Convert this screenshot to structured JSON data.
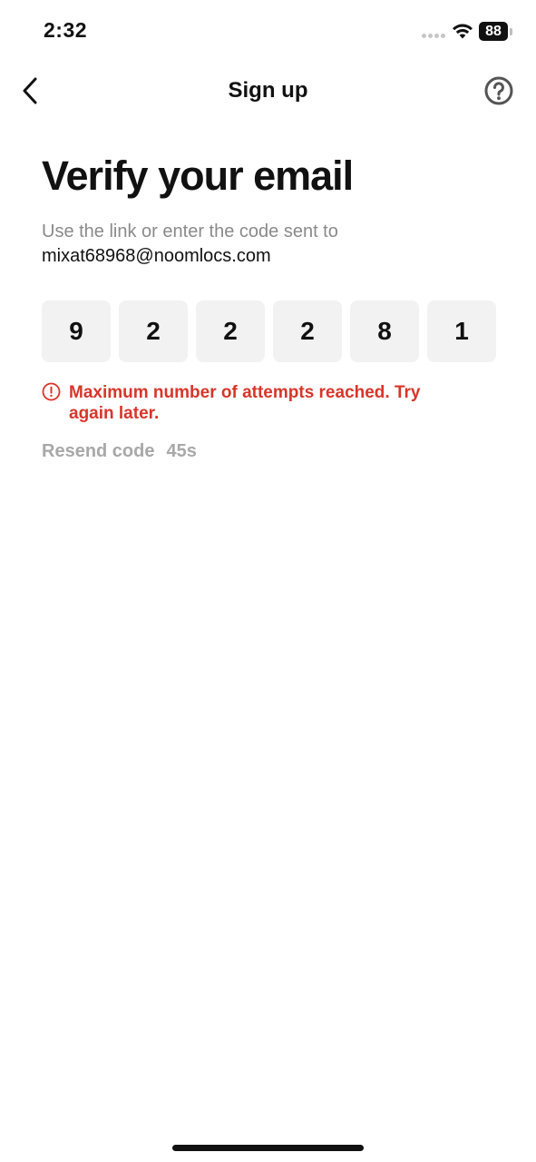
{
  "status_bar": {
    "time": "2:32",
    "battery": "88",
    "icons": [
      "signal-dots",
      "wifi-icon",
      "battery-icon"
    ]
  },
  "nav": {
    "title": "Sign up",
    "back_icon": "chevron-left-icon",
    "help_icon": "question-circle-icon"
  },
  "heading": "Verify your email",
  "subtitle": "Use the link or enter the code sent to",
  "email": "mixat68968@noomlocs.com",
  "code": {
    "digits": [
      "9",
      "2",
      "2",
      "2",
      "8",
      "1"
    ]
  },
  "error": {
    "icon": "info-circle-icon",
    "message": "Maximum number of attempts reached. Try again later."
  },
  "resend": {
    "label": "Resend code",
    "countdown": "45s"
  },
  "colors": {
    "error": "#d8352a",
    "code_box_bg": "#f2f2f2",
    "muted_text": "#8a8a8a",
    "disabled_text": "#a8a8a8"
  }
}
